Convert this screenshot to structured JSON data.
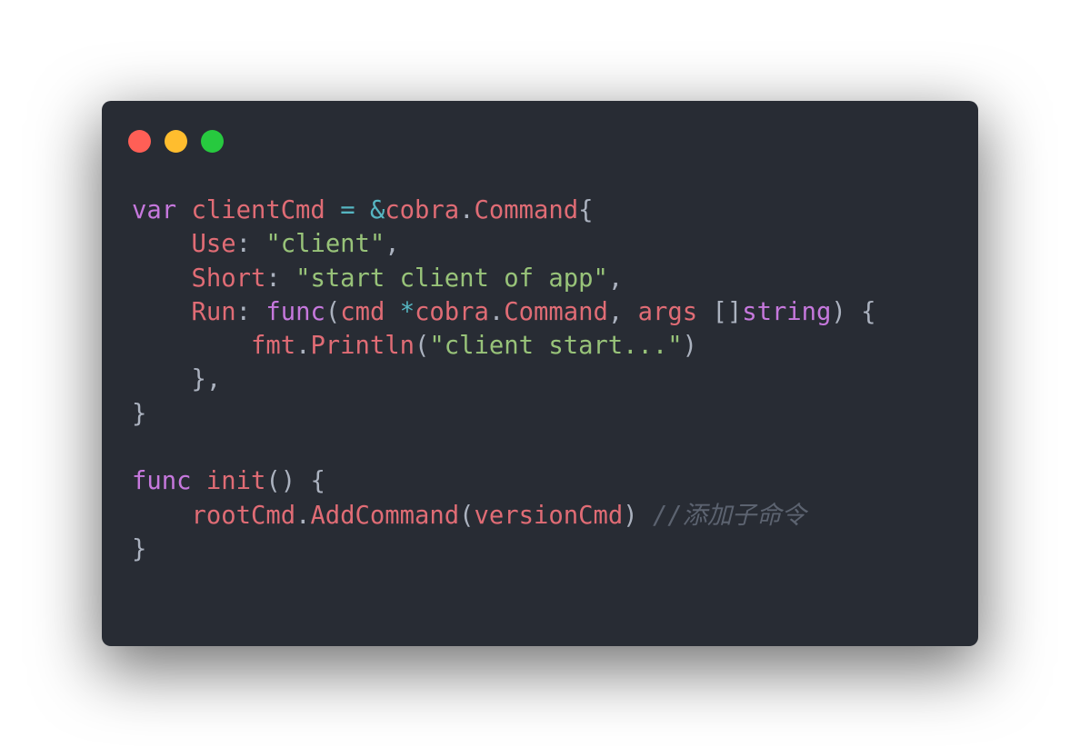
{
  "window": {
    "controls": {
      "close_color": "#ff5f56",
      "minimize_color": "#ffbd2e",
      "maximize_color": "#27c93f"
    },
    "background": "#282c34"
  },
  "code": {
    "language": "go",
    "colors": {
      "keyword": "#c678dd",
      "identifier": "#e06c75",
      "operator": "#56b6c2",
      "string": "#98c379",
      "punctuation": "#abb2bf",
      "comment": "#5c6370"
    },
    "lines": [
      [
        {
          "t": "var",
          "c": "kw"
        },
        {
          "t": " ",
          "c": "pun"
        },
        {
          "t": "clientCmd",
          "c": "var"
        },
        {
          "t": " ",
          "c": "pun"
        },
        {
          "t": "=",
          "c": "op"
        },
        {
          "t": " ",
          "c": "pun"
        },
        {
          "t": "&",
          "c": "op"
        },
        {
          "t": "cobra",
          "c": "var"
        },
        {
          "t": ".",
          "c": "pun"
        },
        {
          "t": "Command",
          "c": "var"
        },
        {
          "t": "{",
          "c": "pun"
        }
      ],
      [
        {
          "t": "    ",
          "c": "pun"
        },
        {
          "t": "Use",
          "c": "var"
        },
        {
          "t": ": ",
          "c": "pun"
        },
        {
          "t": "\"client\"",
          "c": "str"
        },
        {
          "t": ",",
          "c": "pun"
        }
      ],
      [
        {
          "t": "    ",
          "c": "pun"
        },
        {
          "t": "Short",
          "c": "var"
        },
        {
          "t": ": ",
          "c": "pun"
        },
        {
          "t": "\"start client of app\"",
          "c": "str"
        },
        {
          "t": ",",
          "c": "pun"
        }
      ],
      [
        {
          "t": "    ",
          "c": "pun"
        },
        {
          "t": "Run",
          "c": "var"
        },
        {
          "t": ": ",
          "c": "pun"
        },
        {
          "t": "func",
          "c": "kw"
        },
        {
          "t": "(",
          "c": "pun"
        },
        {
          "t": "cmd",
          "c": "var"
        },
        {
          "t": " ",
          "c": "pun"
        },
        {
          "t": "*",
          "c": "op"
        },
        {
          "t": "cobra",
          "c": "var"
        },
        {
          "t": ".",
          "c": "pun"
        },
        {
          "t": "Command",
          "c": "var"
        },
        {
          "t": ", ",
          "c": "pun"
        },
        {
          "t": "args",
          "c": "var"
        },
        {
          "t": " []",
          "c": "pun"
        },
        {
          "t": "string",
          "c": "kw"
        },
        {
          "t": ") {",
          "c": "pun"
        }
      ],
      [
        {
          "t": "        ",
          "c": "pun"
        },
        {
          "t": "fmt",
          "c": "var"
        },
        {
          "t": ".",
          "c": "pun"
        },
        {
          "t": "Println",
          "c": "var"
        },
        {
          "t": "(",
          "c": "pun"
        },
        {
          "t": "\"client start...\"",
          "c": "str"
        },
        {
          "t": ")",
          "c": "pun"
        }
      ],
      [
        {
          "t": "    },",
          "c": "pun"
        }
      ],
      [
        {
          "t": "}",
          "c": "pun"
        }
      ],
      [],
      [
        {
          "t": "func",
          "c": "kw"
        },
        {
          "t": " ",
          "c": "pun"
        },
        {
          "t": "init",
          "c": "var"
        },
        {
          "t": "() {",
          "c": "pun"
        }
      ],
      [
        {
          "t": "    ",
          "c": "pun"
        },
        {
          "t": "rootCmd",
          "c": "var"
        },
        {
          "t": ".",
          "c": "pun"
        },
        {
          "t": "AddCommand",
          "c": "var"
        },
        {
          "t": "(",
          "c": "pun"
        },
        {
          "t": "versionCmd",
          "c": "var"
        },
        {
          "t": ") ",
          "c": "pun"
        },
        {
          "t": "//添加子命令",
          "c": "cmt"
        }
      ],
      [
        {
          "t": "}",
          "c": "pun"
        }
      ]
    ]
  }
}
